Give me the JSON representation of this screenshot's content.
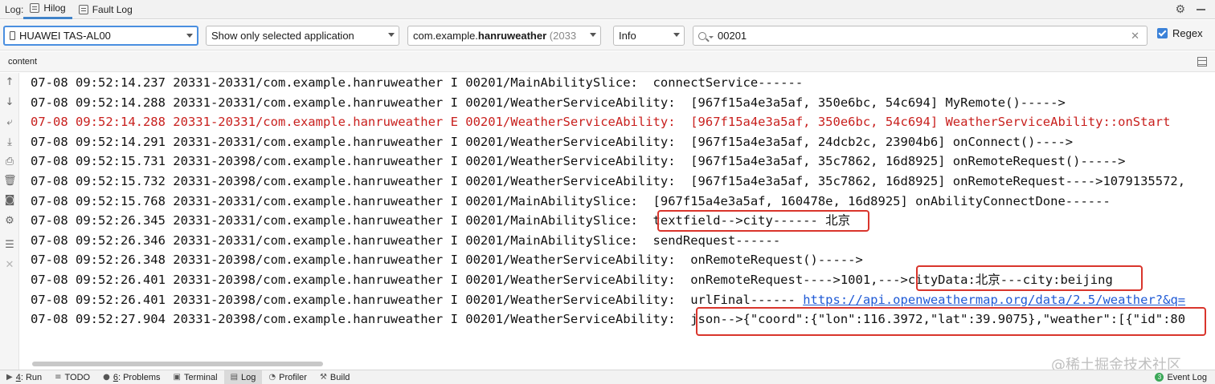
{
  "top_tabs": {
    "log_label": "Log:",
    "items": [
      {
        "label": "Hilog",
        "active": true
      },
      {
        "label": "Fault Log",
        "active": false
      }
    ]
  },
  "filter": {
    "device": "HUAWEI TAS-AL00",
    "app_filter": "Show only selected application",
    "package_prefix": "com.example.",
    "package_bold": "hanruweather",
    "package_pid": "(2033",
    "level": "Info",
    "search_value": "00201",
    "regex_label": "Regex",
    "regex_checked": true
  },
  "content_header": "content",
  "log_lines": [
    {
      "text": "07-08 09:52:14.237 20331-20331/com.example.hanruweather I 00201/MainAbilitySlice:  connectService------",
      "level": "I"
    },
    {
      "text": "07-08 09:52:14.288 20331-20331/com.example.hanruweather I 00201/WeatherServiceAbility:  [967f15a4e3a5af, 350e6bc, 54c694] MyRemote()----->",
      "level": "I"
    },
    {
      "text": "07-08 09:52:14.288 20331-20331/com.example.hanruweather E 00201/WeatherServiceAbility:  [967f15a4e3a5af, 350e6bc, 54c694] WeatherServiceAbility::onStart",
      "level": "E"
    },
    {
      "text": "07-08 09:52:14.291 20331-20331/com.example.hanruweather I 00201/WeatherServiceAbility:  [967f15a4e3a5af, 24dcb2c, 23904b6] onConnect()---->",
      "level": "I"
    },
    {
      "text": "07-08 09:52:15.731 20331-20398/com.example.hanruweather I 00201/WeatherServiceAbility:  [967f15a4e3a5af, 35c7862, 16d8925] onRemoteRequest()----->",
      "level": "I"
    },
    {
      "text": "07-08 09:52:15.732 20331-20398/com.example.hanruweather I 00201/WeatherServiceAbility:  [967f15a4e3a5af, 35c7862, 16d8925] onRemoteRequest---->1079135572,",
      "level": "I"
    },
    {
      "text": "07-08 09:52:15.768 20331-20331/com.example.hanruweather I 00201/MainAbilitySlice:  [967f15a4e3a5af, 160478e, 16d8925] onAbilityConnectDone------",
      "level": "I"
    },
    {
      "text": "07-08 09:52:26.345 20331-20331/com.example.hanruweather I 00201/MainAbilitySlice:  textfield-->city------ 北京",
      "level": "I"
    },
    {
      "text": "07-08 09:52:26.346 20331-20331/com.example.hanruweather I 00201/MainAbilitySlice:  sendRequest------",
      "level": "I"
    },
    {
      "text": "07-08 09:52:26.348 20331-20398/com.example.hanruweather I 00201/WeatherServiceAbility:  onRemoteRequest()----->",
      "level": "I"
    },
    {
      "text": "07-08 09:52:26.401 20331-20398/com.example.hanruweather I 00201/WeatherServiceAbility:  onRemoteRequest---->1001,--->cityData:北京---city:beijing",
      "level": "I"
    },
    {
      "text": "07-08 09:52:26.401 20331-20398/com.example.hanruweather I 00201/WeatherServiceAbility:  urlFinal------ ",
      "level": "I",
      "link": "https://api.openweathermap.org/data/2.5/weather?&q="
    },
    {
      "text": "07-08 09:52:27.904 20331-20398/com.example.hanruweather I 00201/WeatherServiceAbility:  json-->{\"coord\":{\"lon\":116.3972,\"lat\":39.9075},\"weather\":[{\"id\":80",
      "level": "I"
    }
  ],
  "bottom_tabs": [
    {
      "num": "4",
      "label": ": Run",
      "icon": "run-icon"
    },
    {
      "num": "",
      "label": "TODO",
      "icon": "todo-icon"
    },
    {
      "num": "6",
      "label": ": Problems",
      "icon": "problems-icon"
    },
    {
      "num": "",
      "label": "Terminal",
      "icon": "terminal-icon"
    },
    {
      "num": "",
      "label": "Log",
      "icon": "log-icon",
      "active": true
    },
    {
      "num": "",
      "label": "Profiler",
      "icon": "profiler-icon"
    },
    {
      "num": "",
      "label": "Build",
      "icon": "build-icon"
    }
  ],
  "watermark": "@稀土掘金技术社区",
  "event_log": "Event Log",
  "event_log_count": "3",
  "colors": {
    "accent": "#4083c9",
    "error_text": "#c8201e",
    "highlight_box": "#d9352c",
    "link": "#1f5ad6"
  }
}
